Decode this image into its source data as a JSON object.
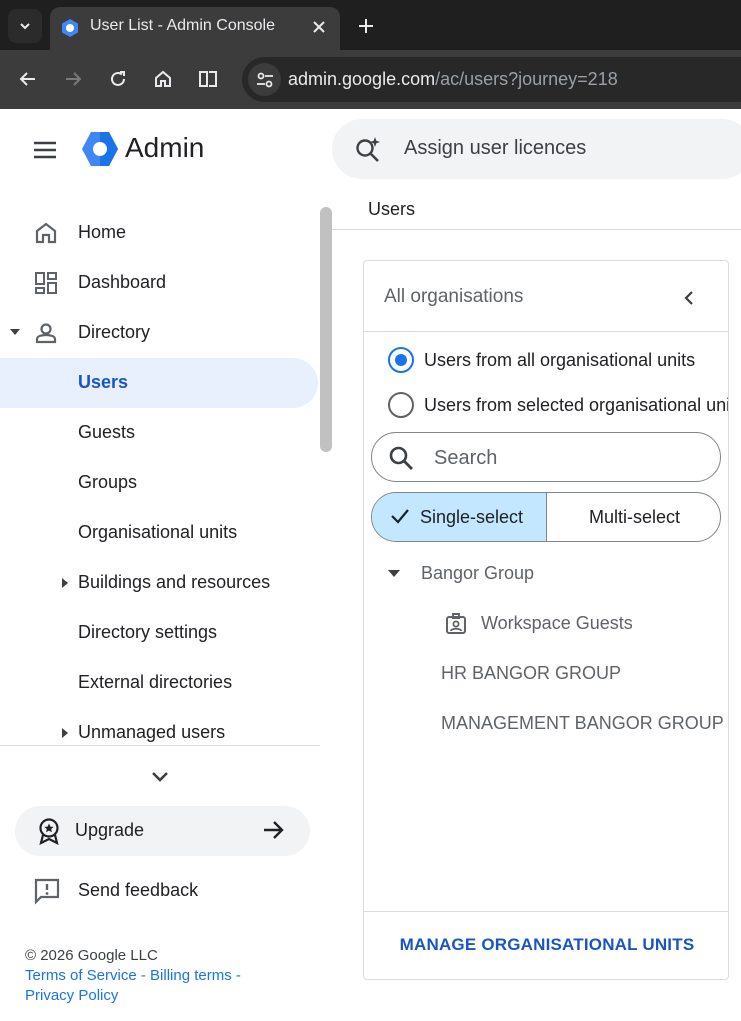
{
  "browser": {
    "tab_title": "User List - Admin Console",
    "url_host": "admin.google.com",
    "url_path": "/ac/users?journey=218"
  },
  "header": {
    "app_name": "Admin",
    "search_text": "Assign user licences"
  },
  "sidebar": {
    "items": [
      {
        "label": "Home",
        "icon": "home-icon"
      },
      {
        "label": "Dashboard",
        "icon": "dashboard-icon"
      },
      {
        "label": "Directory",
        "icon": "person-icon",
        "expanded": true
      },
      {
        "label": "Users",
        "active": true
      },
      {
        "label": "Guests"
      },
      {
        "label": "Groups"
      },
      {
        "label": "Organisational units"
      },
      {
        "label": "Buildings and resources",
        "expandable": true
      },
      {
        "label": "Directory settings"
      },
      {
        "label": "External directories"
      },
      {
        "label": "Unmanaged users",
        "expandable": true
      }
    ],
    "upgrade_label": "Upgrade",
    "feedback_label": "Send feedback",
    "footer": {
      "copyright": "© 2026 Google LLC",
      "terms": "Terms of Service",
      "separator": " - ",
      "billing": "Billing terms",
      "trailing_sep": " -",
      "privacy": "Privacy Policy"
    }
  },
  "main": {
    "breadcrumb": "Users",
    "org_panel": {
      "title": "All organisations",
      "radio_all": "Users from all organisational units",
      "radio_selected": "Users from selected organisational units",
      "search_placeholder": "Search",
      "single_select": "Single-select",
      "multi_select": "Multi-select",
      "tree": {
        "root": "Bangor Group",
        "children": [
          "Workspace Guests",
          "HR BANGOR GROUP",
          "MANAGEMENT BANGOR GROUP"
        ]
      },
      "manage_link": "MANAGE ORGANISATIONAL UNITS"
    }
  },
  "colors": {
    "accent": "#1a73e8",
    "active_bg": "#e8f0fe",
    "segment_selected": "#c2e7ff",
    "logo_blue": "#4285f4"
  }
}
